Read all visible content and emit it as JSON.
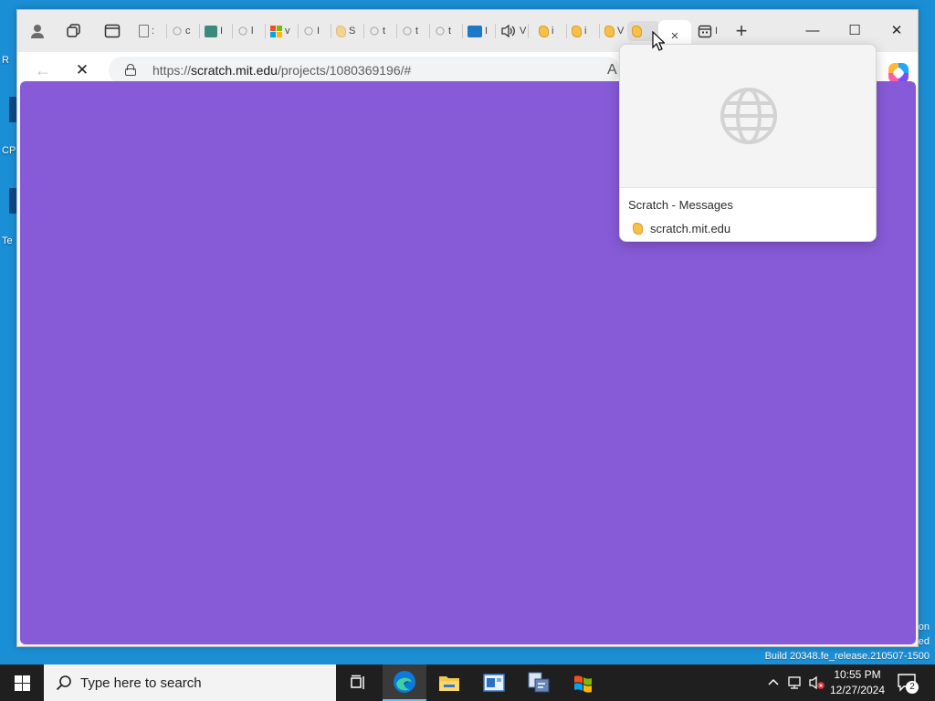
{
  "desktop": {
    "left_fragments": [
      "R",
      "CP",
      "Te"
    ],
    "watermark_lines": [
      "on",
      "ed",
      "Build 20348.fe_release.210507-1500"
    ]
  },
  "browser": {
    "tabstrip": {
      "mini_tab_letters": [
        ":",
        "c",
        "I",
        "l",
        "v",
        "I",
        "l",
        "S",
        "t",
        "t",
        "t",
        "I",
        "V",
        "i",
        "i",
        "V",
        "",
        "I"
      ],
      "active_tab_close": "×",
      "new_tab": "+",
      "controls": {
        "minimize": "—",
        "maximize": "☐",
        "close": "✕"
      }
    },
    "toolbar": {
      "back": "←",
      "stop": "✕",
      "url_prefix": "https://",
      "url_host": "scratch.mit.edu",
      "url_path": "/projects/1080369196/#",
      "read_aloud": "A"
    },
    "hover_card": {
      "title": "Scratch - Messages",
      "site": "scratch.mit.edu"
    },
    "colors": {
      "content_bg": "#875bd8",
      "scratch_orange": "#f6c04a"
    }
  },
  "taskbar": {
    "search_placeholder": "Type here to search",
    "time": "10:55 PM",
    "date": "12/27/2024",
    "notification_count": "2",
    "apps": [
      "task-view-icon",
      "edge-icon",
      "file-explorer-icon",
      "server-manager-icon",
      "powershell-icon",
      "windows-flag-icon"
    ]
  }
}
